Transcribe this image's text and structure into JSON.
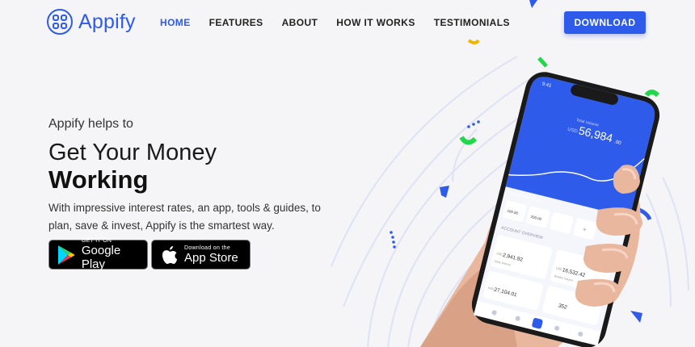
{
  "brand": {
    "name": "Appify",
    "color": "#2f5bea"
  },
  "nav": {
    "items": [
      {
        "label": "HOME",
        "active": true
      },
      {
        "label": "FEATURES",
        "active": false
      },
      {
        "label": "ABOUT",
        "active": false
      },
      {
        "label": "HOW IT WORKS",
        "active": false
      },
      {
        "label": "TESTIMONIALS",
        "active": false
      }
    ],
    "download_label": "DOWNLOAD"
  },
  "hero": {
    "eyebrow": "Appify helps to",
    "title_line1": "Get Your Money",
    "title_line2": "Working",
    "description": "With impressive interest rates, an app, tools & guides, to plan, save & invest, Appify is the smartest way."
  },
  "stores": {
    "google": {
      "small": "GET IT ON",
      "big": "Google Play",
      "icon": "google-play-icon"
    },
    "apple": {
      "small": "Download on the",
      "big": "App Store",
      "icon": "apple-icon"
    }
  },
  "phone": {
    "time": "9:41",
    "total_label": "Total Volume",
    "total_currency": "USD",
    "total_value": "56,984",
    "total_cents": ".00",
    "quick_charge_label": "QUICK CHARGE",
    "charges": [
      "100.00",
      "200.00"
    ],
    "account_overview_label": "ACCOUNT OVERVIEW",
    "cards": [
      {
        "currency": "USD",
        "value": "2,941.92",
        "label": "Daily Volume"
      },
      {
        "currency": "USD",
        "value": "16,532.42",
        "label": "Weekly Volume"
      },
      {
        "currency": "USD",
        "value": "27,104.01",
        "label": ""
      },
      {
        "currency": "",
        "value": "352",
        "label": ""
      }
    ]
  },
  "colors": {
    "accent": "#2f5bea",
    "green": "#22d84a",
    "yellow": "#f5b400",
    "background": "#f5f5f7"
  }
}
